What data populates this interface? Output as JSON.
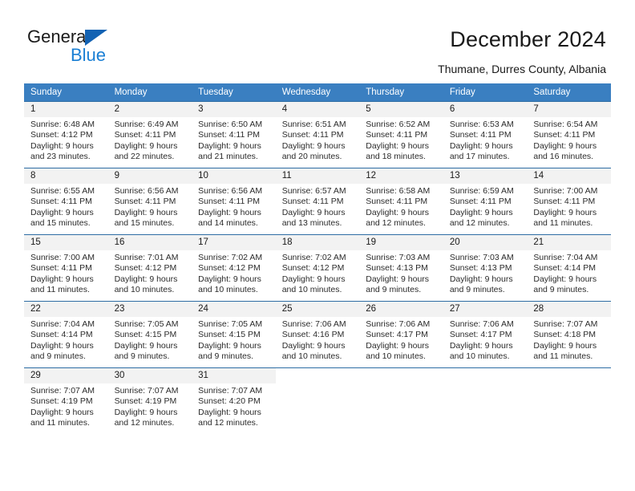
{
  "brand": {
    "name_top": "General",
    "name_bottom": "Blue",
    "accent_color": "#1a7fd4",
    "triangle_color": "#1262b3"
  },
  "header": {
    "title": "December 2024",
    "subtitle": "Thumane, Durres County, Albania"
  },
  "calendar": {
    "header_bg": "#3a7fc1",
    "header_text_color": "#ffffff",
    "daynum_bg": "#f2f2f2",
    "row_border_color": "#2e6da4",
    "weekday_headers": [
      "Sunday",
      "Monday",
      "Tuesday",
      "Wednesday",
      "Thursday",
      "Friday",
      "Saturday"
    ],
    "weeks": [
      [
        {
          "day": "1",
          "sunrise": "Sunrise: 6:48 AM",
          "sunset": "Sunset: 4:12 PM",
          "daylight_line1": "Daylight: 9 hours",
          "daylight_line2": "and 23 minutes."
        },
        {
          "day": "2",
          "sunrise": "Sunrise: 6:49 AM",
          "sunset": "Sunset: 4:11 PM",
          "daylight_line1": "Daylight: 9 hours",
          "daylight_line2": "and 22 minutes."
        },
        {
          "day": "3",
          "sunrise": "Sunrise: 6:50 AM",
          "sunset": "Sunset: 4:11 PM",
          "daylight_line1": "Daylight: 9 hours",
          "daylight_line2": "and 21 minutes."
        },
        {
          "day": "4",
          "sunrise": "Sunrise: 6:51 AM",
          "sunset": "Sunset: 4:11 PM",
          "daylight_line1": "Daylight: 9 hours",
          "daylight_line2": "and 20 minutes."
        },
        {
          "day": "5",
          "sunrise": "Sunrise: 6:52 AM",
          "sunset": "Sunset: 4:11 PM",
          "daylight_line1": "Daylight: 9 hours",
          "daylight_line2": "and 18 minutes."
        },
        {
          "day": "6",
          "sunrise": "Sunrise: 6:53 AM",
          "sunset": "Sunset: 4:11 PM",
          "daylight_line1": "Daylight: 9 hours",
          "daylight_line2": "and 17 minutes."
        },
        {
          "day": "7",
          "sunrise": "Sunrise: 6:54 AM",
          "sunset": "Sunset: 4:11 PM",
          "daylight_line1": "Daylight: 9 hours",
          "daylight_line2": "and 16 minutes."
        }
      ],
      [
        {
          "day": "8",
          "sunrise": "Sunrise: 6:55 AM",
          "sunset": "Sunset: 4:11 PM",
          "daylight_line1": "Daylight: 9 hours",
          "daylight_line2": "and 15 minutes."
        },
        {
          "day": "9",
          "sunrise": "Sunrise: 6:56 AM",
          "sunset": "Sunset: 4:11 PM",
          "daylight_line1": "Daylight: 9 hours",
          "daylight_line2": "and 15 minutes."
        },
        {
          "day": "10",
          "sunrise": "Sunrise: 6:56 AM",
          "sunset": "Sunset: 4:11 PM",
          "daylight_line1": "Daylight: 9 hours",
          "daylight_line2": "and 14 minutes."
        },
        {
          "day": "11",
          "sunrise": "Sunrise: 6:57 AM",
          "sunset": "Sunset: 4:11 PM",
          "daylight_line1": "Daylight: 9 hours",
          "daylight_line2": "and 13 minutes."
        },
        {
          "day": "12",
          "sunrise": "Sunrise: 6:58 AM",
          "sunset": "Sunset: 4:11 PM",
          "daylight_line1": "Daylight: 9 hours",
          "daylight_line2": "and 12 minutes."
        },
        {
          "day": "13",
          "sunrise": "Sunrise: 6:59 AM",
          "sunset": "Sunset: 4:11 PM",
          "daylight_line1": "Daylight: 9 hours",
          "daylight_line2": "and 12 minutes."
        },
        {
          "day": "14",
          "sunrise": "Sunrise: 7:00 AM",
          "sunset": "Sunset: 4:11 PM",
          "daylight_line1": "Daylight: 9 hours",
          "daylight_line2": "and 11 minutes."
        }
      ],
      [
        {
          "day": "15",
          "sunrise": "Sunrise: 7:00 AM",
          "sunset": "Sunset: 4:11 PM",
          "daylight_line1": "Daylight: 9 hours",
          "daylight_line2": "and 11 minutes."
        },
        {
          "day": "16",
          "sunrise": "Sunrise: 7:01 AM",
          "sunset": "Sunset: 4:12 PM",
          "daylight_line1": "Daylight: 9 hours",
          "daylight_line2": "and 10 minutes."
        },
        {
          "day": "17",
          "sunrise": "Sunrise: 7:02 AM",
          "sunset": "Sunset: 4:12 PM",
          "daylight_line1": "Daylight: 9 hours",
          "daylight_line2": "and 10 minutes."
        },
        {
          "day": "18",
          "sunrise": "Sunrise: 7:02 AM",
          "sunset": "Sunset: 4:12 PM",
          "daylight_line1": "Daylight: 9 hours",
          "daylight_line2": "and 10 minutes."
        },
        {
          "day": "19",
          "sunrise": "Sunrise: 7:03 AM",
          "sunset": "Sunset: 4:13 PM",
          "daylight_line1": "Daylight: 9 hours",
          "daylight_line2": "and 9 minutes."
        },
        {
          "day": "20",
          "sunrise": "Sunrise: 7:03 AM",
          "sunset": "Sunset: 4:13 PM",
          "daylight_line1": "Daylight: 9 hours",
          "daylight_line2": "and 9 minutes."
        },
        {
          "day": "21",
          "sunrise": "Sunrise: 7:04 AM",
          "sunset": "Sunset: 4:14 PM",
          "daylight_line1": "Daylight: 9 hours",
          "daylight_line2": "and 9 minutes."
        }
      ],
      [
        {
          "day": "22",
          "sunrise": "Sunrise: 7:04 AM",
          "sunset": "Sunset: 4:14 PM",
          "daylight_line1": "Daylight: 9 hours",
          "daylight_line2": "and 9 minutes."
        },
        {
          "day": "23",
          "sunrise": "Sunrise: 7:05 AM",
          "sunset": "Sunset: 4:15 PM",
          "daylight_line1": "Daylight: 9 hours",
          "daylight_line2": "and 9 minutes."
        },
        {
          "day": "24",
          "sunrise": "Sunrise: 7:05 AM",
          "sunset": "Sunset: 4:15 PM",
          "daylight_line1": "Daylight: 9 hours",
          "daylight_line2": "and 9 minutes."
        },
        {
          "day": "25",
          "sunrise": "Sunrise: 7:06 AM",
          "sunset": "Sunset: 4:16 PM",
          "daylight_line1": "Daylight: 9 hours",
          "daylight_line2": "and 10 minutes."
        },
        {
          "day": "26",
          "sunrise": "Sunrise: 7:06 AM",
          "sunset": "Sunset: 4:17 PM",
          "daylight_line1": "Daylight: 9 hours",
          "daylight_line2": "and 10 minutes."
        },
        {
          "day": "27",
          "sunrise": "Sunrise: 7:06 AM",
          "sunset": "Sunset: 4:17 PM",
          "daylight_line1": "Daylight: 9 hours",
          "daylight_line2": "and 10 minutes."
        },
        {
          "day": "28",
          "sunrise": "Sunrise: 7:07 AM",
          "sunset": "Sunset: 4:18 PM",
          "daylight_line1": "Daylight: 9 hours",
          "daylight_line2": "and 11 minutes."
        }
      ],
      [
        {
          "day": "29",
          "sunrise": "Sunrise: 7:07 AM",
          "sunset": "Sunset: 4:19 PM",
          "daylight_line1": "Daylight: 9 hours",
          "daylight_line2": "and 11 minutes."
        },
        {
          "day": "30",
          "sunrise": "Sunrise: 7:07 AM",
          "sunset": "Sunset: 4:19 PM",
          "daylight_line1": "Daylight: 9 hours",
          "daylight_line2": "and 12 minutes."
        },
        {
          "day": "31",
          "sunrise": "Sunrise: 7:07 AM",
          "sunset": "Sunset: 4:20 PM",
          "daylight_line1": "Daylight: 9 hours",
          "daylight_line2": "and 12 minutes."
        },
        {
          "day": "",
          "sunrise": "",
          "sunset": "",
          "daylight_line1": "",
          "daylight_line2": ""
        },
        {
          "day": "",
          "sunrise": "",
          "sunset": "",
          "daylight_line1": "",
          "daylight_line2": ""
        },
        {
          "day": "",
          "sunrise": "",
          "sunset": "",
          "daylight_line1": "",
          "daylight_line2": ""
        },
        {
          "day": "",
          "sunrise": "",
          "sunset": "",
          "daylight_line1": "",
          "daylight_line2": ""
        }
      ]
    ]
  }
}
